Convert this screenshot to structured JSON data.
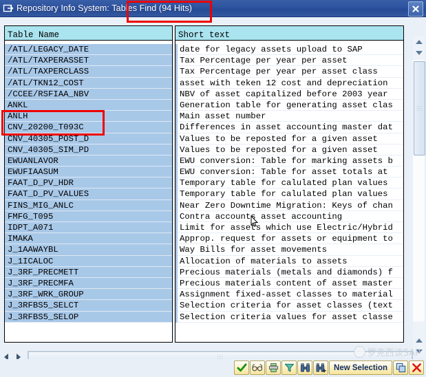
{
  "window": {
    "title": "Repository Info System: Tables Find (94 Hits)",
    "icon": "window-restore-icon",
    "close_label": "✖"
  },
  "grid": {
    "headers": {
      "table_name": "Table Name",
      "short_text": "Short text"
    },
    "rows": [
      {
        "table_name": "/ATL/LEGACY_DATE",
        "short_text": "date for legacy assets upload to SAP"
      },
      {
        "table_name": "/ATL/TAXPERASSET",
        "short_text": "Tax Percentage per year per asset"
      },
      {
        "table_name": "/ATL/TAXPERCLASS",
        "short_text": "Tax Percentage per year per asset class"
      },
      {
        "table_name": "/ATL/TKN12_COST",
        "short_text": "asset with teken 12 cost and depreciation"
      },
      {
        "table_name": "/CCEE/RSFIAA_NBV",
        "short_text": "NBV of asset capitalized before 2003 year"
      },
      {
        "table_name": "ANKL",
        "short_text": "Generation table for generating asset clas"
      },
      {
        "table_name": "ANLH",
        "short_text": "Main asset number"
      },
      {
        "table_name": "CNV_20200_T093C",
        "short_text": "Differences in asset accounting master dat"
      },
      {
        "table_name": "CNV_40305_POST_D",
        "short_text": "Values to be reposted for a given asset"
      },
      {
        "table_name": "CNV_40305_SIM_PD",
        "short_text": "Values to be reposted for a given asset"
      },
      {
        "table_name": "EWUANLAVOR",
        "short_text": "EWU conversion: Table for marking assets b"
      },
      {
        "table_name": "EWUFIAASUM",
        "short_text": "EWU conversion: Table for asset totals at"
      },
      {
        "table_name": "FAAT_D_PV_HDR",
        "short_text": "Temporary table for calulated plan values"
      },
      {
        "table_name": "FAAT_D_PV_VALUES",
        "short_text": "Temporary table for calulated plan values"
      },
      {
        "table_name": "FINS_MIG_ANLC",
        "short_text": "Near Zero Downtime Migration: Keys of chan"
      },
      {
        "table_name": "FMFG_T095",
        "short_text": "Contra accounts asset accounting"
      },
      {
        "table_name": "IDPT_A071",
        "short_text": "Limit for assets which use Electric/Hybrid"
      },
      {
        "table_name": "IMAKA",
        "short_text": "Approp. request for assets or equipment to"
      },
      {
        "table_name": "J_1AAWAYBL",
        "short_text": "Way Bills for asset movements"
      },
      {
        "table_name": "J_1ICALOC",
        "short_text": "Allocation of materials to assets"
      },
      {
        "table_name": "J_3RF_PRECMETT",
        "short_text": "Precious materials (metals and diamonds) f"
      },
      {
        "table_name": "J_3RF_PRECMFA",
        "short_text": "Precious materials content of asset master"
      },
      {
        "table_name": "J_3RF_WRK_GROUP",
        "short_text": "Assignment fixed-asset classes to material"
      },
      {
        "table_name": "J_3RFBS5_SELCT",
        "short_text": "Selection criteria for asset classes (text"
      },
      {
        "table_name": "J_3RFBS5_SELOP",
        "short_text": "Selection criteria values for asset classe"
      }
    ]
  },
  "toolbar": {
    "buttons": [
      {
        "name": "continue-button",
        "icon": "green-check-icon",
        "label": ""
      },
      {
        "name": "display-button",
        "icon": "glasses-icon",
        "label": ""
      },
      {
        "name": "print-button",
        "icon": "printer-icon",
        "label": ""
      },
      {
        "name": "filter-button",
        "icon": "funnel-icon",
        "label": ""
      },
      {
        "name": "find-button",
        "icon": "binoculars-icon",
        "label": ""
      },
      {
        "name": "find-next-button",
        "icon": "binoculars-plus-icon",
        "label": ""
      },
      {
        "name": "new-selection-button",
        "icon": "",
        "label": "New Selection"
      },
      {
        "name": "copy-button",
        "icon": "copy-icon",
        "label": ""
      },
      {
        "name": "cancel-button",
        "icon": "red-x-icon",
        "label": ""
      }
    ]
  },
  "watermark": {
    "text": "罗克西谈SAP"
  },
  "colors": {
    "titlebar": "#2f54a0",
    "header_cyan": "#a9e4ef",
    "row_blue": "#a8c8e8",
    "annotation_red": "#ee0000",
    "button_yellow": "#f6e49b"
  }
}
